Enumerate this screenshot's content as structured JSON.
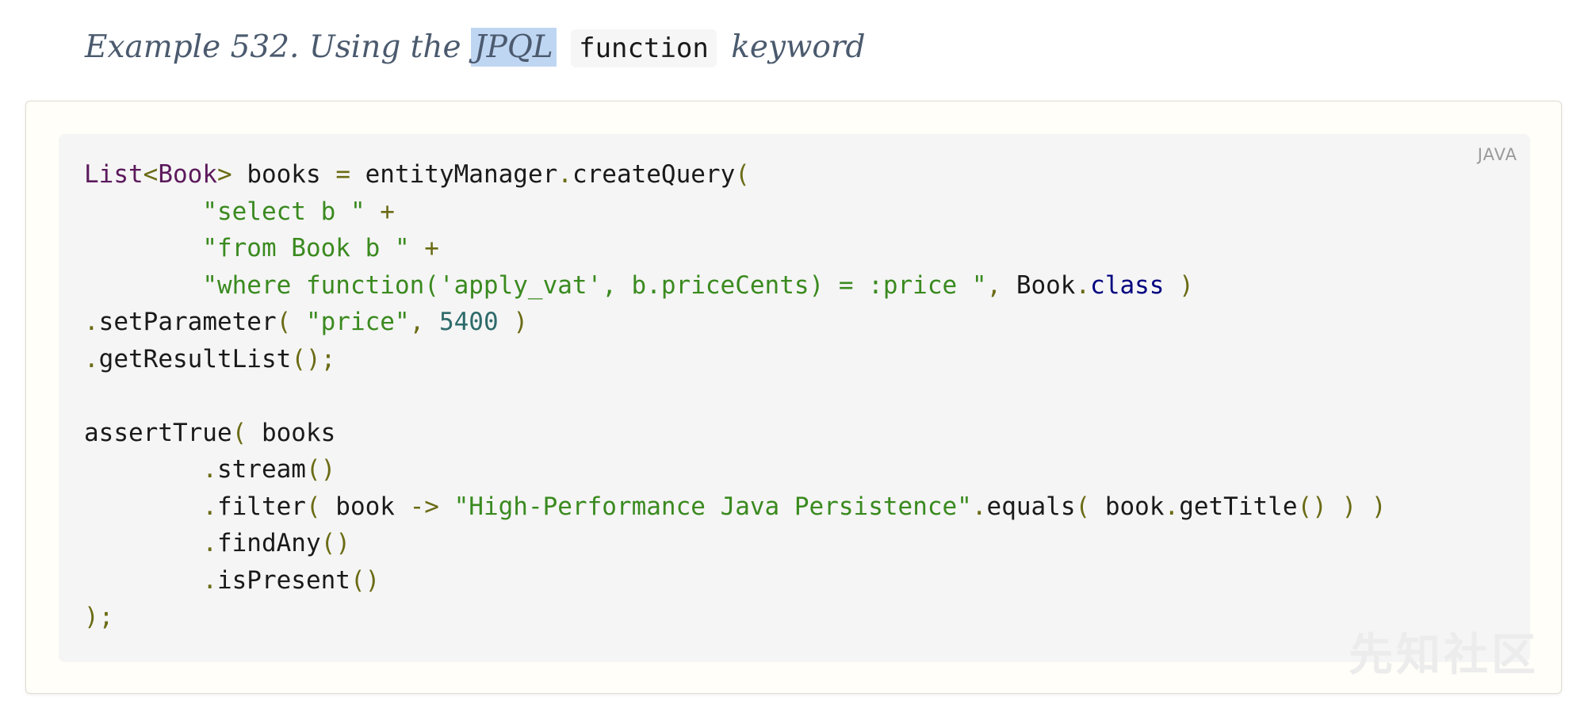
{
  "heading": {
    "prefix": "Example 532. Using the ",
    "highlight": "JPQL",
    "code": "function",
    "suffix": "keyword"
  },
  "code_block": {
    "language": "JAVA",
    "lines": [
      "List<Book> books = entityManager.createQuery(",
      "        \"select b \" +",
      "        \"from Book b \" +",
      "        \"where function('apply_vat', b.priceCents) = :price \", Book.class )",
      ".setParameter( \"price\", 5400 )",
      ".getResultList();",
      "",
      "assertTrue( books",
      "        .stream()",
      "        .filter( book -> \"High-Performance Java Persistence\".equals( book.getTitle() ) )",
      "        .findAny()",
      "        .isPresent()",
      ");"
    ]
  },
  "watermark": "先知社区"
}
